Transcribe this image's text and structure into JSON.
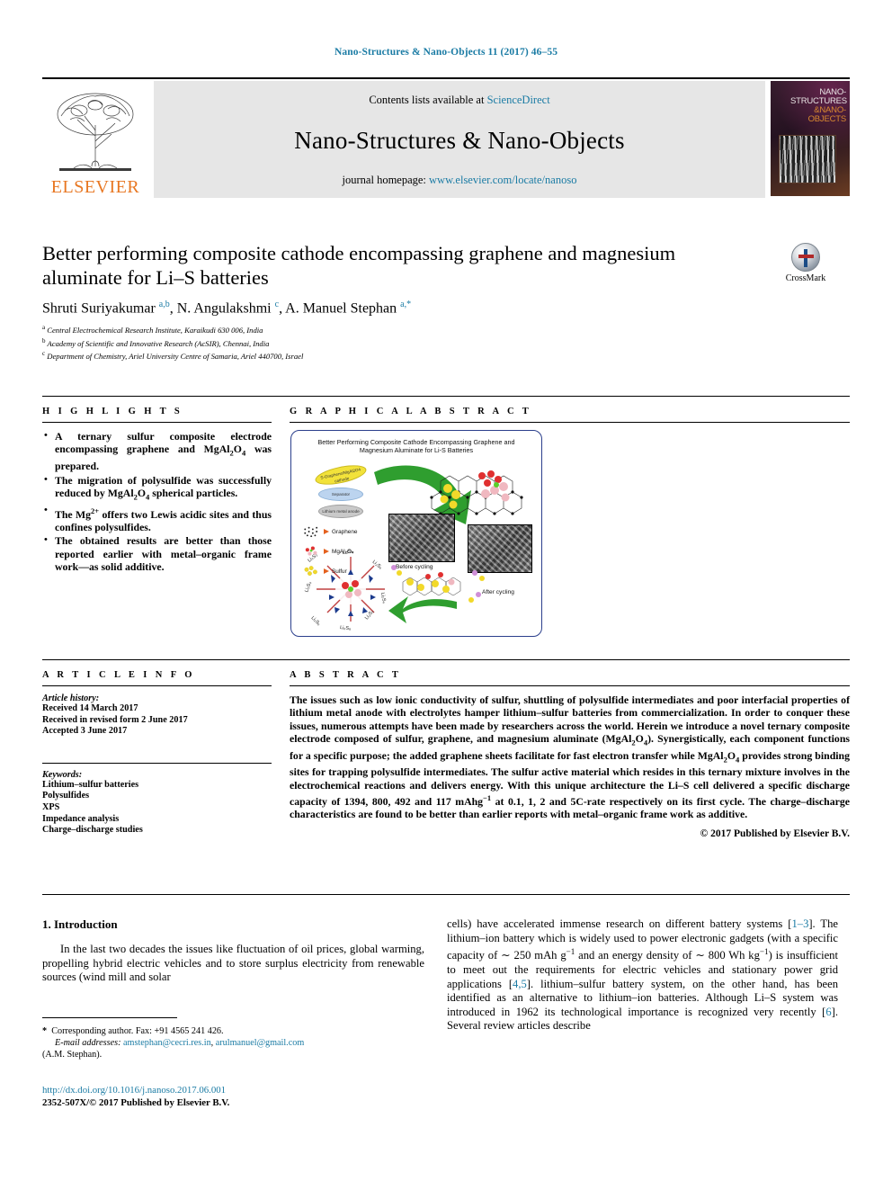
{
  "running_head": "Nano-Structures & Nano-Objects 11 (2017) 46–55",
  "masthead": {
    "publisher_name": "ELSEVIER",
    "contents_prefix": "Contents lists available at ",
    "contents_link": "ScienceDirect",
    "journal_title": "Nano-Structures & Nano-Objects",
    "homepage_prefix": "journal homepage: ",
    "homepage_url": "www.elsevier.com/locate/nanoso",
    "cover_line1": "NANO-",
    "cover_line2": "STRUCTURES",
    "cover_line3": "&NANO-",
    "cover_line4": "OBJECTS"
  },
  "article": {
    "title": "Better performing composite cathode encompassing graphene and magnesium aluminate for Li–S batteries",
    "authors_html": "Shruti Suriyakumar <sup>a,b</sup>, N. Angulakshmi <sup>c</sup>, A. Manuel Stephan <sup>a,*</sup>",
    "affiliations": [
      {
        "marker": "a",
        "text": "Central Electrochemical Research Institute, Karaikudi 630 006, India"
      },
      {
        "marker": "b",
        "text": "Academy of Scientific and Innovative Research (AcSIR), Chennai, India"
      },
      {
        "marker": "c",
        "text": "Department of Chemistry, Ariel University Centre of Samaria, Ariel 440700, Israel"
      }
    ],
    "crossmark_label": "CrossMark"
  },
  "highlights": {
    "heading": "H I G H L I G H T S",
    "items": [
      "A ternary sulfur composite electrode encompassing graphene and MgAl<sub>2</sub>O<sub>4</sub> was prepared.",
      "The migration of polysulfide was successfully reduced by MgAl<sub>2</sub>O<sub>4</sub> spherical particles.",
      "The Mg<sup>2+</sup> offers two Lewis acidic sites and thus confines polysulfides.",
      "The obtained results are better than those reported earlier with metal–organic frame work—as solid additive."
    ]
  },
  "graphical_abstract": {
    "heading": "G R A P H I C A L   A B S T R A C T",
    "figure_title": "Better Performing Composite Cathode Encompassing Graphene and Magnesium Aluminate for Li-S Batteries",
    "pills": [
      "S-Graphene/MgAl2O4 cathode",
      "Separator",
      "Lithium metal anode"
    ],
    "legend": [
      {
        "icon": "graphene-lattice-icon",
        "label": "Graphene"
      },
      {
        "icon": "mgal2o4-cluster-icon",
        "label": "MgAl₂O₄"
      },
      {
        "icon": "sulfur-cluster-icon",
        "label": "Sulfur"
      }
    ],
    "captions": [
      "Before cycling",
      "After cycling"
    ],
    "radial_labels": [
      "Li₂S₈",
      "Li₂S₆",
      "Li₂S₄",
      "Li₂S₂",
      "Li₂S₈",
      "Li₂S₆",
      "Li₂S₄",
      "Li₂S₂"
    ]
  },
  "article_info": {
    "heading": "A R T I C L E   I N F O",
    "history_label": "Article history:",
    "history": [
      "Received 14 March 2017",
      "Received in revised form 2 June 2017",
      "Accepted 3 June 2017"
    ],
    "keywords_label": "Keywords:",
    "keywords": [
      "Lithium–sulfur batteries",
      "Polysulfides",
      "XPS",
      "Impedance analysis",
      "Charge–discharge studies"
    ]
  },
  "abstract": {
    "heading": "A B S T R A C T",
    "text_html": "The issues such as low ionic conductivity of sulfur, shuttling of polysulfide intermediates and poor interfacial properties of lithium metal anode with electrolytes hamper lithium–sulfur batteries from commercialization. In order to conquer these issues, numerous attempts have been made by researchers across the world. Herein we introduce a novel ternary composite electrode composed of sulfur, graphene, and magnesium aluminate (MgAl<sub>2</sub>O<sub>4</sub>). Synergistically, each component functions for a specific purpose; the added graphene sheets facilitate for fast electron transfer while MgAl<sub>2</sub>O<sub>4</sub> provides strong binding sites for trapping polysulfide intermediates. The sulfur active material which resides in this ternary mixture involves in the electrochemical reactions and delivers energy. With this unique architecture the Li–S cell delivered a specific discharge capacity of 1394, 800, 492 and 117 mAhg<sup>−1</sup> at 0.1, 1, 2 and 5C-rate respectively on its first cycle. The charge–discharge characteristics are found to be better than earlier reports with metal–organic frame work as additive.",
    "copyright": "© 2017 Published by Elsevier B.V."
  },
  "body": {
    "section_heading": "1. Introduction",
    "left_paragraph_html": "In the last two decades the issues like fluctuation of oil prices, global warming, propelling hybrid electric vehicles and to store surplus electricity from renewable sources (wind mill and solar",
    "right_paragraph_html": "cells) have accelerated immense research on different battery systems [<span class=\"ref\">1–3</span>]. The lithium–ion battery which is widely used to power electronic gadgets (with a specific capacity of ∼ 250 mAh g<sup>−1</sup> and an energy density of ∼ 800 Wh kg<sup>−1</sup>) is insufficient to meet out the requirements for electric vehicles and stationary power grid applications [<span class=\"ref\">4,5</span>]. lithium–sulfur battery system, on the other hand, has been identified as an alternative to lithium–ion batteries. Although Li–S system was introduced in 1962 its technological importance is recognized very recently [<span class=\"ref\">6</span>]. Several review articles describe"
  },
  "footer": {
    "corresponding_html": "<span style=\"font-weight:bold;\">*</span>&nbsp; Corresponding author. Fax: +91 4565 241 426.",
    "email_html": "<span class=\"em-it\">E-mail addresses:</span> <span class=\"mail\">amstephan@cecri.res.in</span>, <span class=\"mail\">arulmanuel@gmail.com</span>",
    "email_owner": "(A.M. Stephan).",
    "doi": "http://dx.doi.org/10.1016/j.nanoso.2017.06.001",
    "issn_line": "2352-507X/© 2017 Published by Elsevier B.V."
  }
}
